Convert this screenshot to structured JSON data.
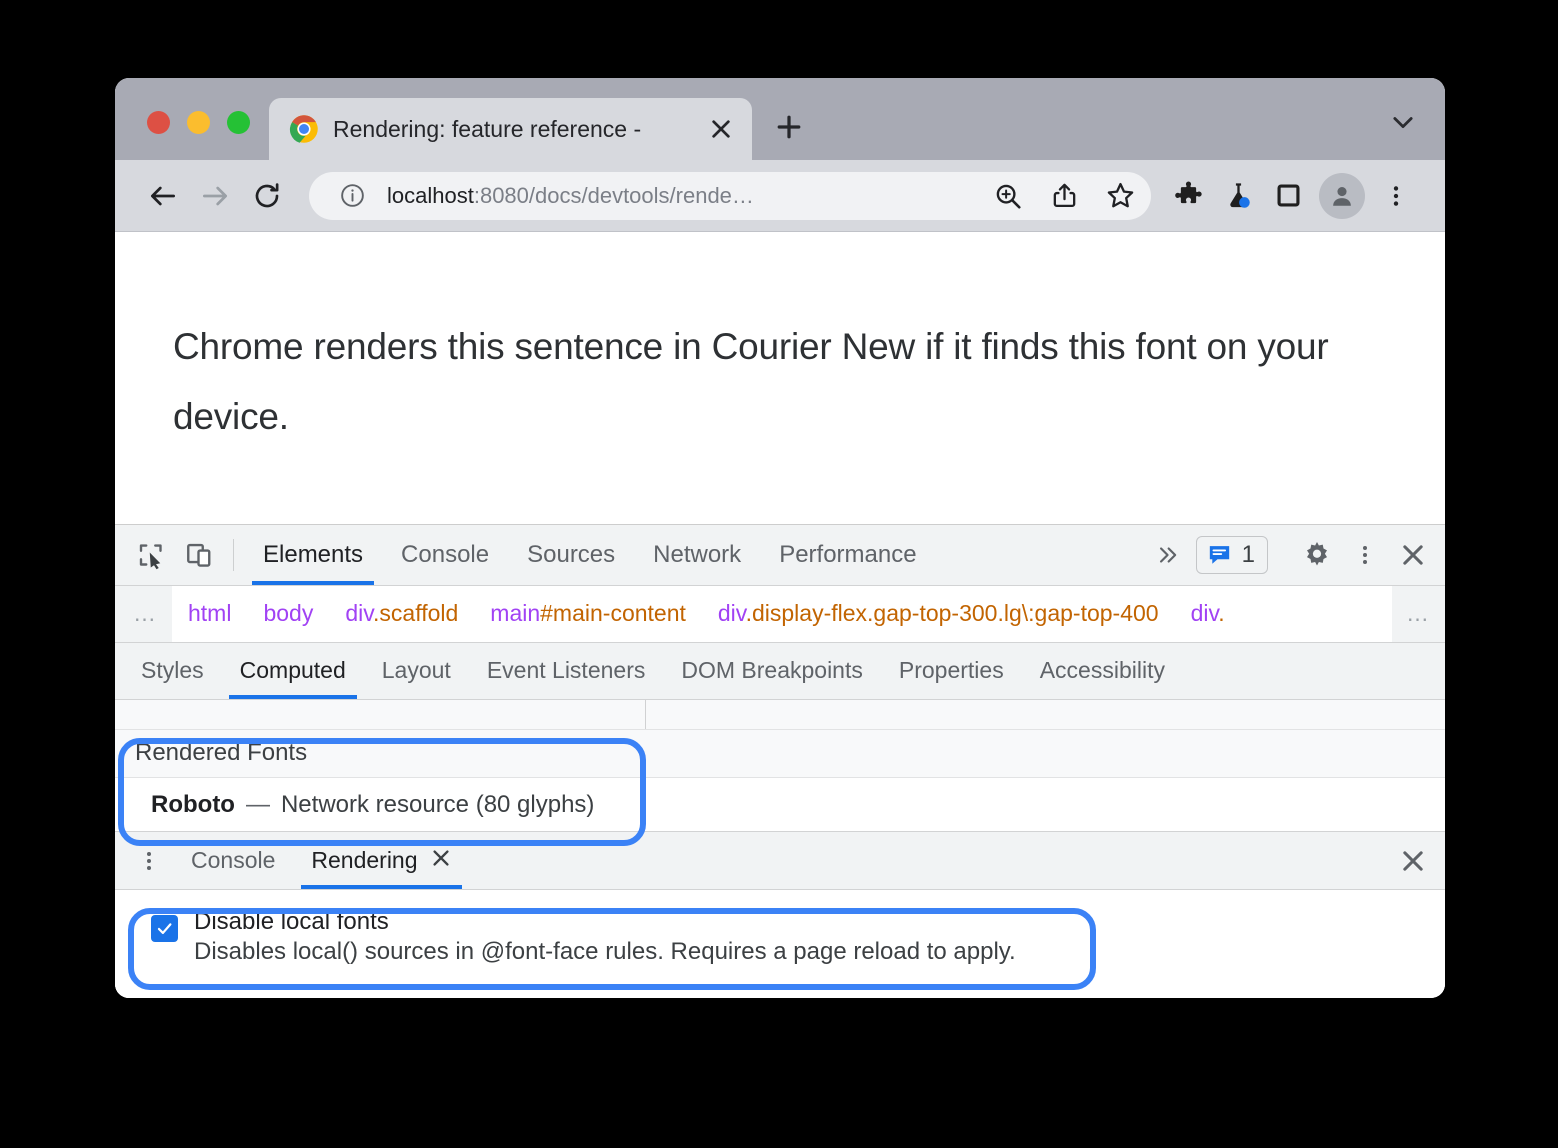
{
  "browser": {
    "traffic_lights": [
      "close",
      "minimize",
      "maximize"
    ],
    "tab": {
      "title": "Rendering: feature reference -",
      "favicon": "chrome-logo-icon",
      "close_icon": "close-icon"
    },
    "new_tab_label": "+",
    "tab_list_chevron": "chevron-down-icon",
    "toolbar": {
      "back_icon": "back-arrow-icon",
      "forward_icon": "forward-arrow-icon",
      "reload_icon": "reload-icon",
      "info_icon": "info-circle-icon",
      "url_host": "localhost",
      "url_rest": ":8080/docs/devtools/rende…",
      "zoom_icon": "zoom-in-icon",
      "share_icon": "share-icon",
      "bookmark_icon": "star-icon",
      "extensions_icon": "puzzle-piece-icon",
      "experiments_icon": "flask-icon",
      "side_panel_icon": "side-panel-icon",
      "profile_icon": "avatar-icon",
      "menu_icon": "three-dots-vertical-icon"
    }
  },
  "page": {
    "sentence": "Chrome renders this sentence in Courier New if it finds this font on your device."
  },
  "devtools": {
    "inspect_icon": "inspect-cursor-icon",
    "device_toolbar_icon": "device-toolbar-icon",
    "tabs": [
      {
        "label": "Elements",
        "active": true
      },
      {
        "label": "Console",
        "active": false
      },
      {
        "label": "Sources",
        "active": false
      },
      {
        "label": "Network",
        "active": false
      },
      {
        "label": "Performance",
        "active": false
      }
    ],
    "more_tabs_icon": "chevron-double-right-icon",
    "message_badge": {
      "icon": "message-bubble-icon",
      "count": "1"
    },
    "settings_icon": "gear-icon",
    "more_options_icon": "three-dots-vertical-icon",
    "close_icon": "close-icon",
    "breadcrumb": {
      "leading_ellipsis": "…",
      "items": [
        {
          "tag": "html",
          "sel": ""
        },
        {
          "tag": "body",
          "sel": ""
        },
        {
          "tag": "div",
          "sel": ".scaffold"
        },
        {
          "tag": "main",
          "sel": "#main-content"
        },
        {
          "tag": "div",
          "sel": ".display-flex.gap-top-300.lg\\:gap-top-400"
        },
        {
          "tag": "div",
          "sel": "."
        }
      ],
      "trailing_ellipsis": "…"
    },
    "subtabs": [
      {
        "label": "Styles",
        "active": false
      },
      {
        "label": "Computed",
        "active": true
      },
      {
        "label": "Layout",
        "active": false
      },
      {
        "label": "Event Listeners",
        "active": false
      },
      {
        "label": "DOM Breakpoints",
        "active": false
      },
      {
        "label": "Properties",
        "active": false
      },
      {
        "label": "Accessibility",
        "active": false
      }
    ],
    "rendered_fonts": {
      "header": "Rendered Fonts",
      "font_name": "Roboto",
      "dash": "—",
      "description": "Network resource (80 glyphs)"
    },
    "drawer": {
      "menu_icon": "three-dots-vertical-icon",
      "tabs": [
        {
          "label": "Console",
          "active": false,
          "closable": false
        },
        {
          "label": "Rendering",
          "active": true,
          "closable": true
        }
      ],
      "tab_close_icon": "close-icon",
      "close_icon": "close-icon",
      "setting": {
        "checked": true,
        "title": "Disable local fonts",
        "description": "Disables local() sources in @font-face rules. Requires a page reload to apply."
      }
    }
  },
  "annotations": {
    "accent_color": "#3b82f6",
    "highlighted": [
      "rendered-fonts-section",
      "disable-local-fonts-setting"
    ]
  }
}
